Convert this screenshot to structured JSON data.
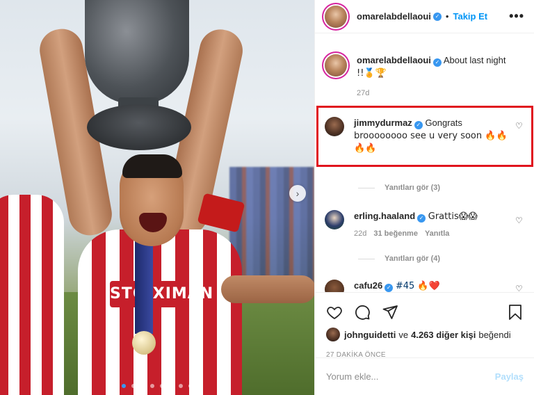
{
  "header": {
    "username": "omarelabdellaoui",
    "follow_label": "Takip Et",
    "bullet": "•",
    "more_label": "•••"
  },
  "caption": {
    "username": "omarelabdellaoui",
    "text": "About last night",
    "text2": "!!🏅🏆",
    "age": "27d"
  },
  "comments": [
    {
      "username": "jimmydurmaz",
      "text": "Gongrats",
      "text2": "broooooooo see u very soon 🔥🔥",
      "text3": "🔥🔥",
      "replies_label": "Yanıtları gör (3)"
    },
    {
      "username": "erling.haaland",
      "text": "Grattis😱😱",
      "age": "22d",
      "likes": "31 beğenme",
      "reply_label": "Yanıtla",
      "replies_label": "Yanıtları gör (4)"
    },
    {
      "username": "cafu26",
      "text": "#45 🔥❤️"
    }
  ],
  "likes": {
    "user": "johnguidetti",
    "rest": "ve",
    "count": "4.263 diğer kişi",
    "suffix": "beğendi"
  },
  "timestamp": "27 DAKİKA ÖNCE",
  "add_comment": {
    "placeholder": "Yorum ekle...",
    "post_label": "Paylaş"
  },
  "photo": {
    "sponsor_text": "STOIXIMAN",
    "next_glyph": "›",
    "dot_count": 8
  },
  "colors": {
    "accent": "#0095f6",
    "highlight": "#e0141e",
    "verified": "#3897f0"
  }
}
